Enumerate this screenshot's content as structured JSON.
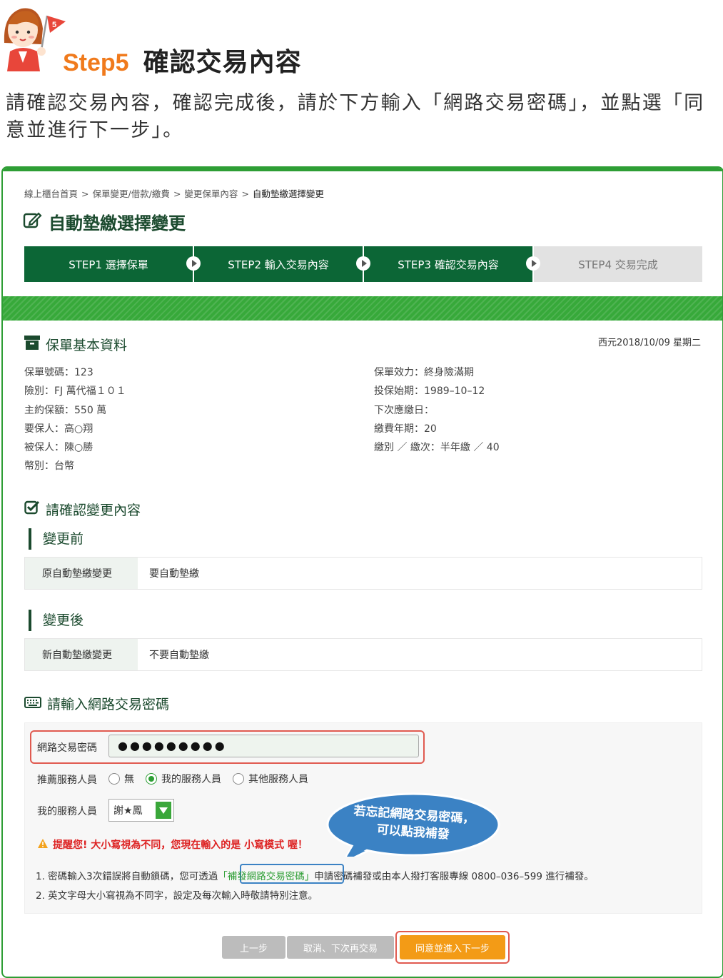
{
  "header": {
    "step_label": "Step5",
    "step_heading": "確認交易內容",
    "mascot_flag": "5",
    "instruction": "請確認交易內容，確認完成後，請於下方輸入「網路交易密碼」，並點選「同意並進行下一步」。"
  },
  "breadcrumb": [
    "線上櫃台首頁",
    "保單變更/借款/繳費",
    "變更保單內容",
    "自動墊繳選擇變更"
  ],
  "breadcrumb_sep": ">",
  "page_title": "自動墊繳選擇變更",
  "steps": [
    {
      "label": "STEP1 選擇保單",
      "active": true
    },
    {
      "label": "STEP2 輸入交易內容",
      "active": true
    },
    {
      "label": "STEP3 確認交易內容",
      "active": true
    },
    {
      "label": "STEP4 交易完成",
      "active": false
    }
  ],
  "policy_info": {
    "title": "保單基本資料",
    "date": "西元2018/10/09 星期二",
    "left": [
      "保單號碼：123",
      "險別：FJ 萬代福１０１",
      "主約保額：550 萬",
      "要保人：高○翔",
      "被保人：陳○勝",
      "幣別：台幣"
    ],
    "right": [
      "保單效力：終身險滿期",
      "投保始期：1989–10–12",
      "下次應繳日：",
      "繳費年期：20",
      "繳別 ／ 繳次：半年繳  ／  40"
    ]
  },
  "confirm": {
    "title": "請確認變更內容",
    "before_title": "變更前",
    "before_key": "原自動墊繳變更",
    "before_value": "要自動墊繳",
    "after_title": "變更後",
    "after_key": "新自動墊繳變更",
    "after_value": "不要自動墊繳"
  },
  "password": {
    "title": "請輸入網路交易密碼",
    "label": "網路交易密碼",
    "masked_value": "●●●●●●●●●",
    "referrer_label": "推薦服務人員",
    "referrer_options": [
      "無",
      "我的服務人員",
      "其他服務人員"
    ],
    "referrer_selected": "我的服務人員",
    "agent_label": "我的服務人員",
    "agent_value": "謝★鳳",
    "warning": "提醒您! 大小寫視為不同，您現在輸入的是 小寫模式 喔！",
    "note1_pre": "1. 密碼輸入3次錯誤將自動鎖碼，您可透過",
    "note1_link": "「補發網路交易密碼」",
    "note1_post": "申請密碼補發或由本人撥打客服專線 0800–036–599 進行補發。",
    "note2": "2. 英文字母大小寫視為不同字，設定及每次輸入時敬請特別注意。",
    "bubble_line1": "若忘記網路交易密碼，",
    "bubble_line2": "可以點我補發"
  },
  "buttons": {
    "prev": "上一步",
    "cancel": "取消、下次再交易",
    "next": "同意並進入下一步"
  },
  "colors": {
    "brand_green": "#0c6636",
    "accent_orange": "#f39b16",
    "highlight_red": "#e05a50",
    "bubble_blue": "#3b82c4"
  }
}
